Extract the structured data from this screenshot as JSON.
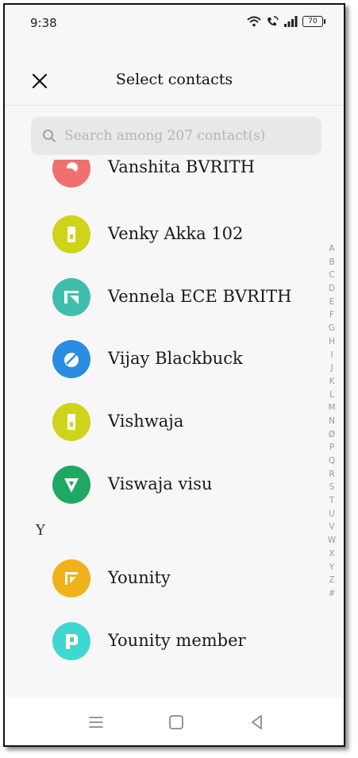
{
  "status_bar": {
    "time": "9:38",
    "battery": "70"
  },
  "header": {
    "title": "Select contacts"
  },
  "search": {
    "placeholder": "Search among 207 contact(s)"
  },
  "contacts": [
    {
      "name": "Vanshita BVRITH",
      "color": "#f07070"
    },
    {
      "name": "Venky Akka 102",
      "color": "#cdd41a"
    },
    {
      "name": "Vennela ECE BVRITH",
      "color": "#3fbfab"
    },
    {
      "name": "Vijay Blackbuck",
      "color": "#2a8ce0"
    },
    {
      "name": "Vishwaja",
      "color": "#cdd41a"
    },
    {
      "name": "Viswaja visu",
      "color": "#1ea862"
    },
    {
      "name": "Younity",
      "color": "#f0b21a"
    },
    {
      "name": "Younity member",
      "color": "#3fd8d0"
    }
  ],
  "section_y": "Y",
  "alpha_index": [
    "A",
    "B",
    "C",
    "D",
    "E",
    "F",
    "G",
    "H",
    "I",
    "J",
    "K",
    "L",
    "M",
    "N",
    "Ø",
    "P",
    "Q",
    "R",
    "S",
    "T",
    "U",
    "V",
    "W",
    "X",
    "Y",
    "Z",
    "#"
  ],
  "colors": {
    "accent": "#e8e8e8",
    "background": "#f7f7f7"
  }
}
